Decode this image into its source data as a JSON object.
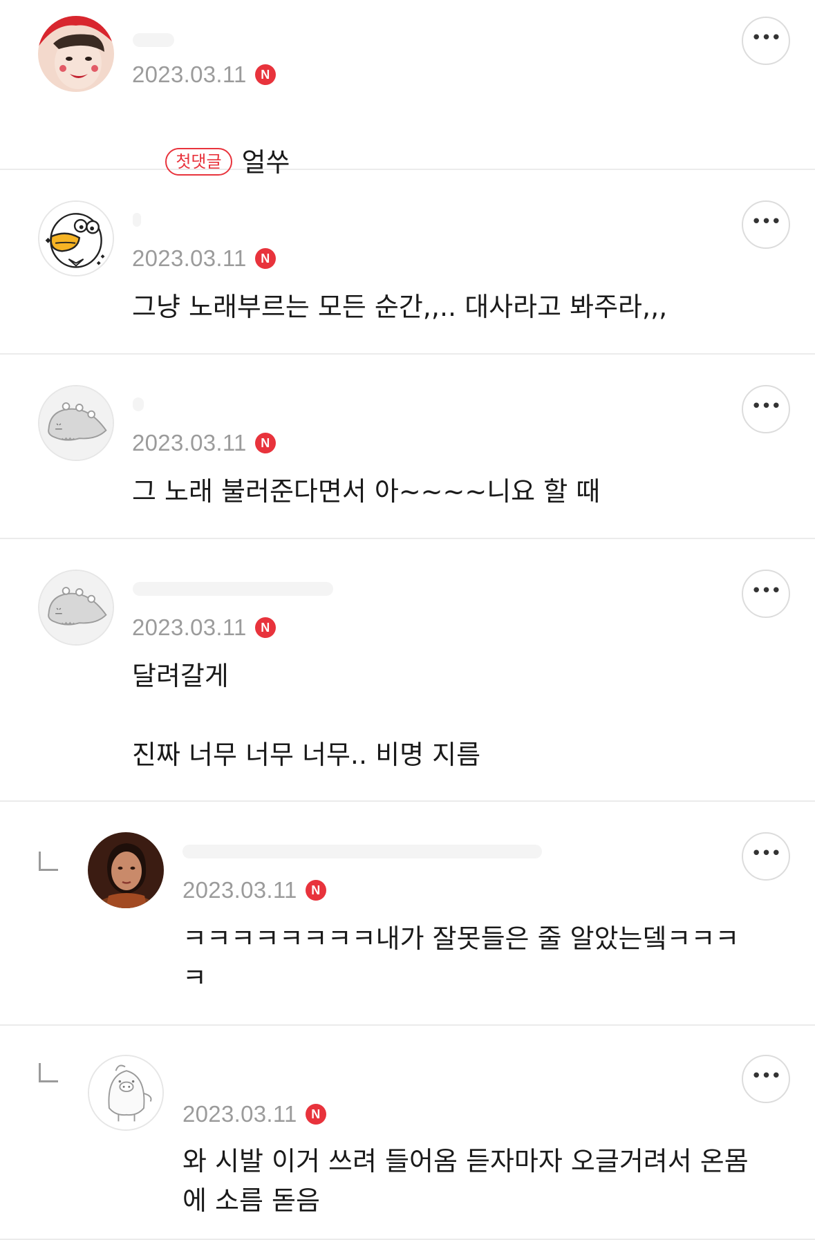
{
  "comments": [
    {
      "date": "2023.03.11",
      "new_badge": "N",
      "first_badge": "첫댓글",
      "text": "얼쑤",
      "avatar": "photo-avatar-red-beret",
      "reply": false
    },
    {
      "date": "2023.03.11",
      "new_badge": "N",
      "text": "그냥 노래부르는 모든 순간,,.. 대사라고 봐주라,,,",
      "avatar": "duck-character-avatar",
      "reply": false
    },
    {
      "date": "2023.03.11",
      "new_badge": "N",
      "text": "그 노래 불러준다면서 아~~~~니요 할 때",
      "avatar": "default-dino-avatar",
      "reply": false
    },
    {
      "date": "2023.03.11",
      "new_badge": "N",
      "text": "달려갈게\n\n진짜 너무 너무 너무.. 비명 지름",
      "avatar": "default-dino-avatar",
      "reply": false
    },
    {
      "date": "2023.03.11",
      "new_badge": "N",
      "text": "ㅋㅋㅋㅋㅋㅋㅋㅋ내가 잘못들은 줄 알았는뎈ㅋㅋㅋ\nㅋ",
      "avatar": "photo-avatar-woman",
      "reply": true
    },
    {
      "date": "2023.03.11",
      "new_badge": "N",
      "text": "와 시발 이거 쓰려 들어옴 듣자마자 오글거려서 온몸\n에 소름 돋음",
      "avatar": "pig-character-avatar",
      "reply": true
    }
  ],
  "more_button_label": "•••",
  "colors": {
    "accent": "#e8333c",
    "date": "#9b9b9b",
    "divider": "#ebebeb"
  }
}
